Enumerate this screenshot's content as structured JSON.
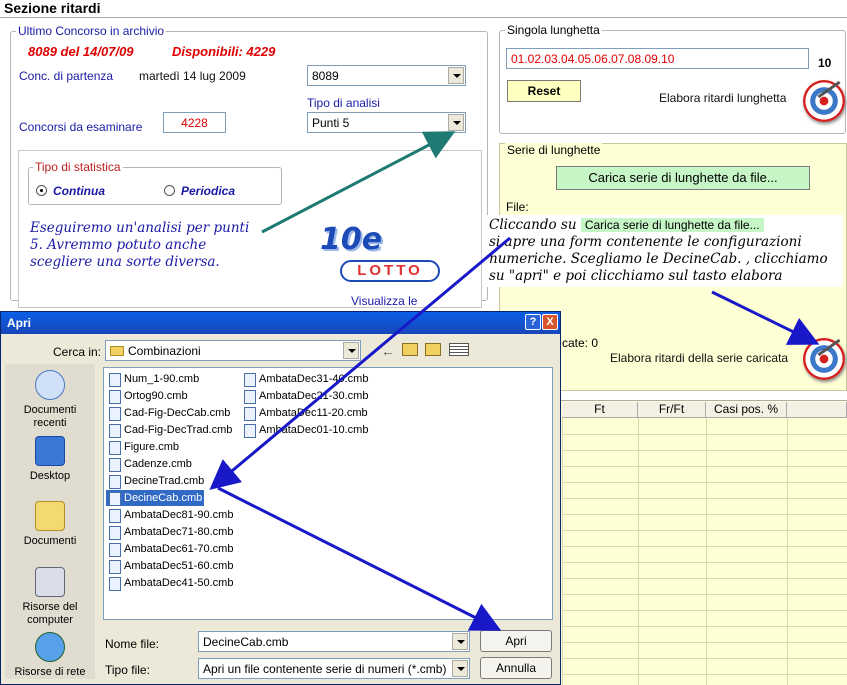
{
  "page": {
    "title": "Sezione ritardi",
    "ultimo_concorso": {
      "legend": "Ultimo Concorso in archivio",
      "date": "8089 del 14/07/09",
      "disponibili": "Disponibili: 4229"
    },
    "conc_partenza": {
      "label": "Conc. di partenza",
      "date": "martedì 14 lug 2009",
      "value": "8089"
    },
    "tipo_analisi": {
      "label": "Tipo di analisi",
      "value": "Punti 5"
    },
    "concorsi_esaminare": {
      "label": "Concorsi da esaminare",
      "value": "4228"
    },
    "tipo_statistica": {
      "legend": "Tipo di statistica",
      "options": [
        "Continua",
        "Periodica"
      ],
      "selected": "Continua"
    },
    "logo_top": "10e",
    "logo_bottom": "LOTTO",
    "visualizza": "Visualizza le",
    "singola_lunghetta": {
      "legend": "Singola lunghetta",
      "value": "01.02.03.04.05.06.07.08.09.10",
      "count": "10",
      "reset_label": "Reset",
      "elabora_label": "Elabora ritardi lunghetta"
    },
    "serie_lunghette": {
      "legend": "Serie di lunghette",
      "carica_label": "Carica serie di lunghette da file...",
      "file_label": "File:",
      "caricate_label": "cate: 0",
      "elabora_label": "Elabora ritardi della serie caricata"
    },
    "table": {
      "columns": [
        "Ft",
        "Fr/Ft",
        "Casi pos. %"
      ]
    }
  },
  "annotations": {
    "note1": [
      "Eseguiremo un'analisi per punti",
      "5. Avremmo potuto anche",
      "scegliere una sorte diversa."
    ],
    "note2_prefix": "Cliccando su",
    "note2_button": "Carica serie di lunghette da file...",
    "note2_lines": [
      "si apre una form contenente le configurazioni",
      "numeriche. Scegliamo le DecineCab. , clicchiamo",
      "su \"apri\" e poi clicchiamo sul tasto elabora"
    ]
  },
  "dialog": {
    "title": "Apri",
    "help": "?",
    "close": "X",
    "cerca_in_label": "Cerca in:",
    "cerca_in_value": "Combinazioni",
    "places": [
      "Documenti recenti",
      "Desktop",
      "Documenti",
      "Risorse del computer",
      "Risorse di rete"
    ],
    "files_col1": [
      "Num_1-90.cmb",
      "Ortog90.cmb",
      "Cad-Fig-DecCab.cmb",
      "Cad-Fig-DecTrad.cmb",
      "Figure.cmb",
      "Cadenze.cmb",
      "DecineTrad.cmb",
      "DecineCab.cmb",
      "AmbataDec81-90.cmb",
      "AmbataDec71-80.cmb",
      "AmbataDec61-70.cmb",
      "AmbataDec51-60.cmb",
      "AmbataDec41-50.cmb"
    ],
    "files_col2": [
      "AmbataDec31-40.cmb",
      "AmbataDec21-30.cmb",
      "AmbataDec11-20.cmb",
      "AmbataDec01-10.cmb"
    ],
    "selected_file": "DecineCab.cmb",
    "nome_file_label": "Nome file:",
    "nome_file_value": "DecineCab.cmb",
    "tipo_file_label": "Tipo file:",
    "tipo_file_value": "Apri un file contenente serie di numeri (*.cmb)",
    "apri_label": "Apri",
    "annulla_label": "Annulla"
  },
  "colors": {
    "accent_red": "#e00000",
    "label_blue": "#1a1aa6",
    "panel_yellow": "#ffffd6",
    "button_green": "#c6f5c6",
    "arrow_teal": "#1e7a72",
    "arrow_blue": "#1818c8"
  }
}
